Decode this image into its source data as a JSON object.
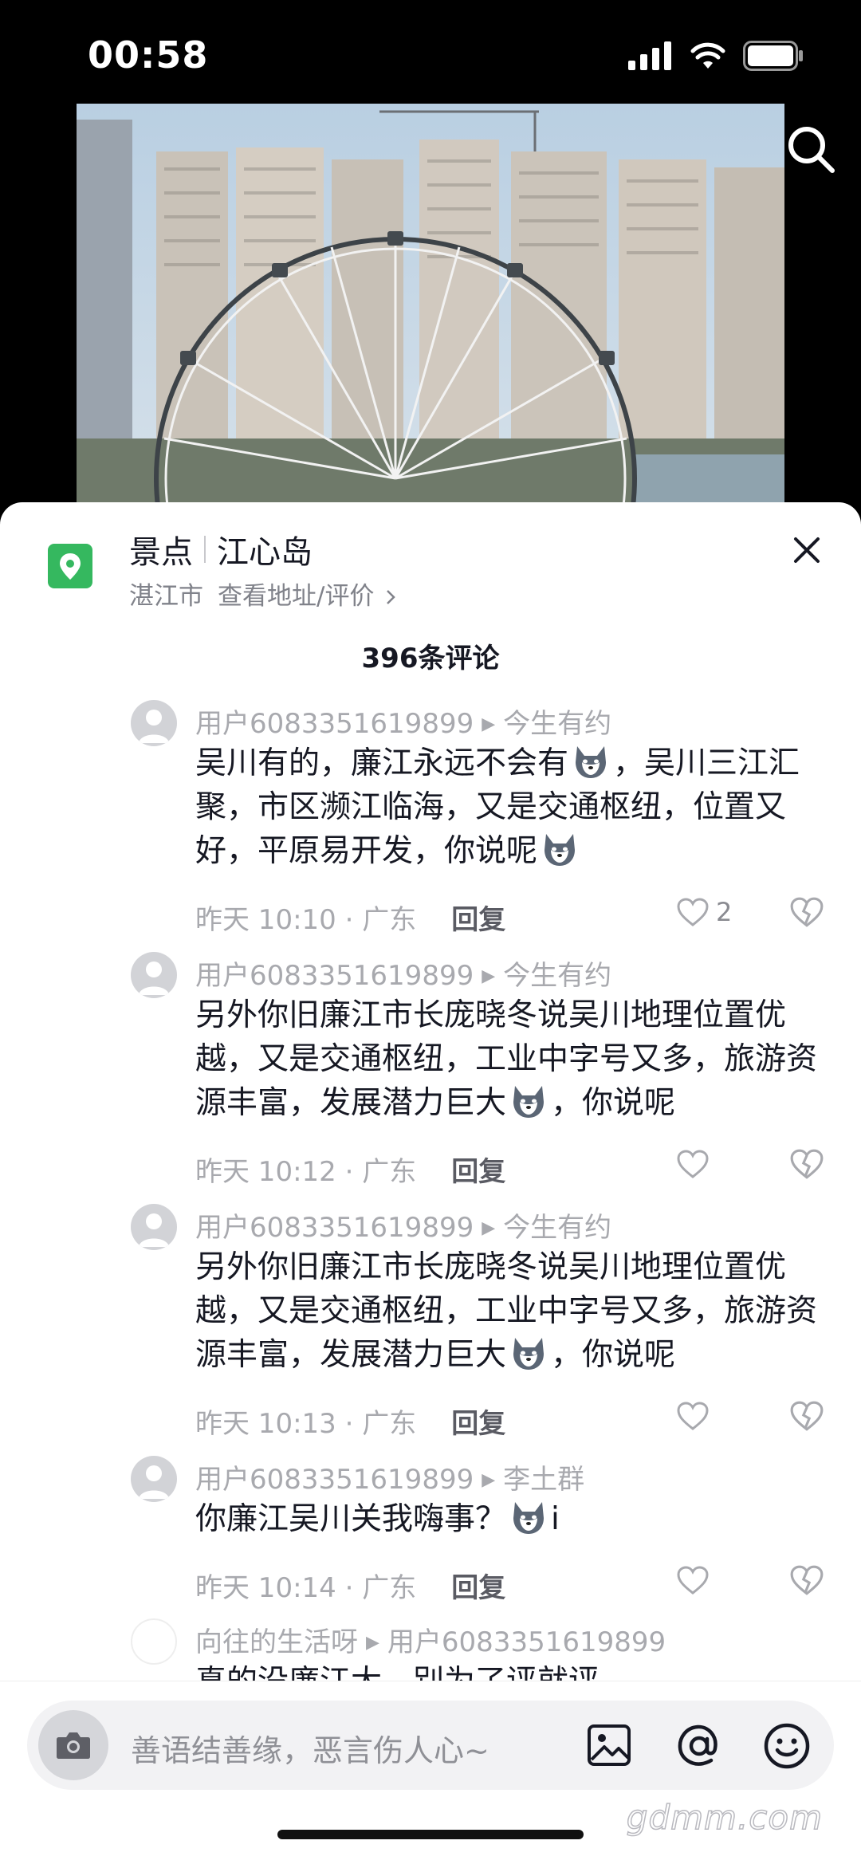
{
  "status_bar": {
    "time": "00:58"
  },
  "poi": {
    "category": "景点",
    "name": "江心岛",
    "city": "湛江市",
    "link": "查看地址/评价",
    "close_icon": "close-icon"
  },
  "comments_header": {
    "count_label": "396条评论"
  },
  "comments": [
    {
      "author": "用户6083351619899",
      "reply_to": "今生有约",
      "text_parts": [
        "吴川有的，廉江永远不会有",
        "，吴川三江汇聚，市区濒江临海，又是交通枢纽，位置又好，平原易开发，你说呢",
        ""
      ],
      "time": "昨天 10:10 · 广东",
      "reply_label": "回复",
      "likes": "2"
    },
    {
      "author": "用户6083351619899",
      "reply_to": "今生有约",
      "text_parts": [
        "另外你旧廉江市长庞晓冬说吴川地理位置优越，又是交通枢纽，工业中字号又多，旅游资源丰富，发展潜力巨大",
        "，你说呢"
      ],
      "time": "昨天 10:12 · 广东",
      "reply_label": "回复"
    },
    {
      "author": "用户6083351619899",
      "reply_to": "今生有约",
      "text_parts": [
        "另外你旧廉江市长庞晓冬说吴川地理位置优越，又是交通枢纽，工业中字号又多，旅游资源丰富，发展潜力巨大",
        "，你说呢"
      ],
      "time": "昨天 10:13 · 广东",
      "reply_label": "回复"
    },
    {
      "author": "用户6083351619899",
      "reply_to": "李土群",
      "text_parts": [
        "你廉江吴川关我嗨事？",
        "i"
      ],
      "time": "昨天 10:14 · 广东",
      "reply_label": "回复"
    },
    {
      "author": "向往的生活呀",
      "reply_to": "用户6083351619899",
      "text_parts": [
        "真的没廉江大，别为了评就评"
      ]
    }
  ],
  "input_bar": {
    "placeholder": "善语结善缘，恶言伤人心~",
    "icons": [
      "camera-icon",
      "image-icon",
      "at-icon",
      "emoji-icon"
    ]
  },
  "watermark": "gdmm.com",
  "colors": {
    "poi_green": "#35b85f",
    "meta_gray": "#a8a9ae",
    "text_dark": "#161823"
  }
}
